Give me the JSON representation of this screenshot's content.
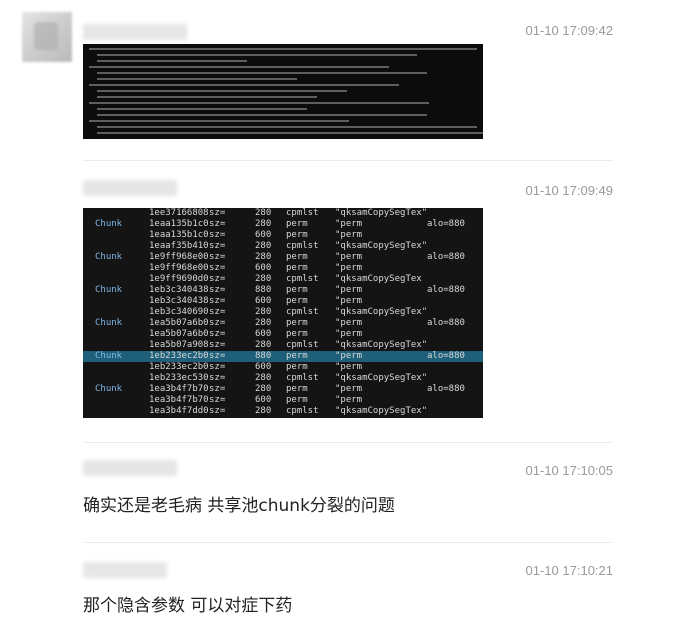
{
  "messages": [
    {
      "time": "01-10 17:09:42",
      "type": "image"
    },
    {
      "time": "01-10 17:09:49",
      "type": "image"
    },
    {
      "time": "01-10 17:10:05",
      "text": "确实还是老毛病 共享池chunk分裂的问题"
    },
    {
      "time": "01-10 17:10:21",
      "text": "那个隐含参数 可以对症下药"
    }
  ],
  "terminal": {
    "rows": [
      {
        "chunk": "",
        "addr": "1ee37166808",
        "sz": "sz=",
        "size": "280",
        "type": "cpmlst",
        "desc": "\"qksamCopySegTex\"",
        "alo": ""
      },
      {
        "chunk": "Chunk",
        "addr": "1eaa135b1c0",
        "sz": "sz=",
        "size": "280",
        "type": "perm",
        "desc": "\"perm",
        "alo": "alo=880"
      },
      {
        "chunk": "",
        "addr": "1eaa135b1c0",
        "sz": "sz=",
        "size": "600",
        "type": "perm",
        "desc": "\"perm",
        "alo": ""
      },
      {
        "chunk": "",
        "addr": "1eaaf35b410",
        "sz": "sz=",
        "size": "280",
        "type": "cpmlst",
        "desc": "\"qksamCopySegTex\"",
        "alo": ""
      },
      {
        "chunk": "Chunk",
        "addr": "1e9ff968e00",
        "sz": "sz=",
        "size": "280",
        "type": "perm",
        "desc": "\"perm",
        "alo": "alo=880"
      },
      {
        "chunk": "",
        "addr": "1e9ff968e00",
        "sz": "sz=",
        "size": "600",
        "type": "perm",
        "desc": "\"perm",
        "alo": ""
      },
      {
        "chunk": "",
        "addr": "1e9ff9690d0",
        "sz": "sz=",
        "size": "280",
        "type": "cpmlst",
        "desc": "\"qksamCopySegTex",
        "alo": ""
      },
      {
        "chunk": "Chunk",
        "addr": "1eb3c340438",
        "sz": "sz=",
        "size": "880",
        "type": "perm",
        "desc": "\"perm",
        "alo": "alo=880"
      },
      {
        "chunk": "",
        "addr": "1eb3c340438",
        "sz": "sz=",
        "size": "600",
        "type": "perm",
        "desc": "\"perm",
        "alo": ""
      },
      {
        "chunk": "",
        "addr": "1eb3c340690",
        "sz": "sz=",
        "size": "280",
        "type": "cpmlst",
        "desc": "\"qksamCopySegTex\"",
        "alo": ""
      },
      {
        "chunk": "Chunk",
        "addr": "1ea5b07a6b0",
        "sz": "sz=",
        "size": "280",
        "type": "perm",
        "desc": "\"perm",
        "alo": "alo=880"
      },
      {
        "chunk": "",
        "addr": "1ea5b07a6b0",
        "sz": "sz=",
        "size": "600",
        "type": "perm",
        "desc": "\"perm",
        "alo": ""
      },
      {
        "chunk": "",
        "addr": "1ea5b07a908",
        "sz": "sz=",
        "size": "280",
        "type": "cpmlst",
        "desc": "\"qksamCopySegTex\"",
        "alo": ""
      },
      {
        "chunk": "Chunk",
        "addr": "1eb233ec2b0",
        "sz": "sz=",
        "size": "880",
        "type": "perm",
        "desc": "\"perm",
        "alo": "alo=880",
        "highlight": true
      },
      {
        "chunk": "",
        "addr": "1eb233ec2b0",
        "sz": "sz=",
        "size": "600",
        "type": "perm",
        "desc": "\"perm",
        "alo": ""
      },
      {
        "chunk": "",
        "addr": "1eb233ec530",
        "sz": "sz=",
        "size": "280",
        "type": "cpmlst",
        "desc": "\"qksamCopySegTex\"",
        "alo": ""
      },
      {
        "chunk": "Chunk",
        "addr": "1ea3b4f7b70",
        "sz": "sz=",
        "size": "280",
        "type": "perm",
        "desc": "\"perm",
        "alo": "alo=880"
      },
      {
        "chunk": "",
        "addr": "1ea3b4f7b70",
        "sz": "sz=",
        "size": "600",
        "type": "perm",
        "desc": "\"perm",
        "alo": ""
      },
      {
        "chunk": "",
        "addr": "1ea3b4f7dd0",
        "sz": "sz=",
        "size": "280",
        "type": "cpmlst",
        "desc": "\"qksamCopySegTex\"",
        "alo": ""
      }
    ]
  },
  "colors": {
    "highlight_row": "#1e5f7a",
    "timestamp": "#9a9a9a",
    "terminal_bg": "#141414"
  }
}
